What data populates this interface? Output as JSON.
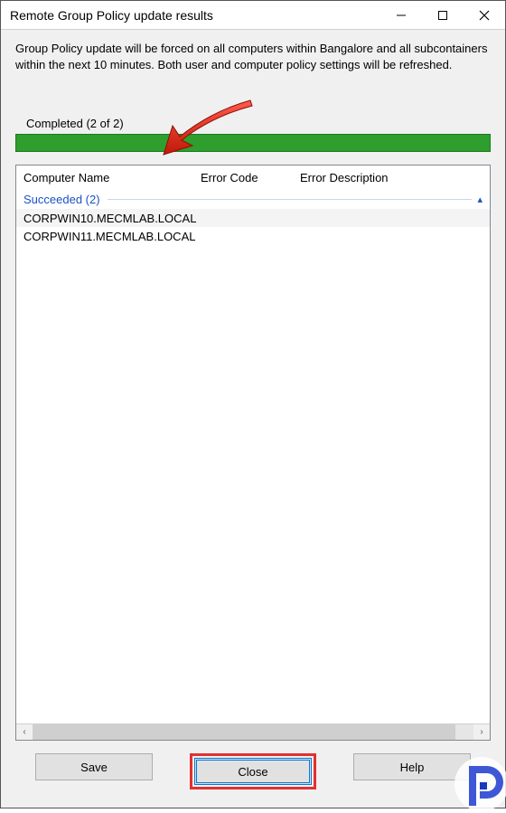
{
  "window": {
    "title": "Remote Group Policy update results"
  },
  "description": "Group Policy update will be forced on all computers within Bangalore and all subcontainers within the next 10 minutes. Both user and computer policy settings will be refreshed.",
  "progress": {
    "label": "Completed (2 of 2)",
    "percent": 100
  },
  "columns": {
    "name": "Computer Name",
    "code": "Error Code",
    "desc": "Error Description"
  },
  "group": {
    "label": "Succeeded (2)"
  },
  "rows": [
    {
      "name": "CORPWIN10.MECMLAB.LOCAL",
      "code": "",
      "desc": ""
    },
    {
      "name": "CORPWIN11.MECMLAB.LOCAL",
      "code": "",
      "desc": ""
    }
  ],
  "buttons": {
    "save": "Save",
    "close": "Close",
    "help": "Help"
  }
}
